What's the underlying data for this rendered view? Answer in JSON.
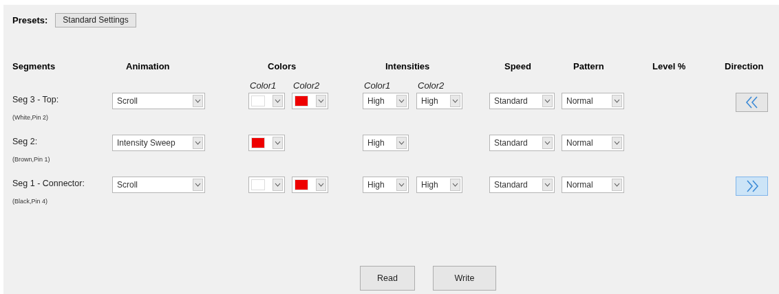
{
  "presets": {
    "label": "Presets:",
    "button": "Standard Settings"
  },
  "headers": [
    "Segments",
    "Animation",
    "Colors",
    "Intensities",
    "Speed",
    "Pattern",
    "Level %",
    "Direction"
  ],
  "subheaders": {
    "colors": [
      "Color1",
      "Color2"
    ],
    "intensities": [
      "Color1",
      "Color2"
    ]
  },
  "segments": [
    {
      "label": "Seg 3 - Top:",
      "wiring": "(White,Pin 2)",
      "animation": "Scroll",
      "colors": [
        {
          "color": "#ffffff"
        },
        {
          "color": "#ee0000"
        }
      ],
      "intensities": [
        "High",
        "High"
      ],
      "speed": "Standard",
      "pattern": "Normal",
      "direction": {
        "kind": "left",
        "pressed": false
      }
    },
    {
      "label": "Seg 2:",
      "wiring": "(Brown,Pin 1)",
      "animation": "Intensity Sweep",
      "colors": [
        {
          "color": "#ee0000"
        }
      ],
      "intensities": [
        "High"
      ],
      "speed": "Standard",
      "pattern": "Normal"
    },
    {
      "label": "Seg 1 - Connector:",
      "wiring": "(Black,Pin 4)",
      "animation": "Scroll",
      "colors": [
        {
          "color": "#ffffff"
        },
        {
          "color": "#ee0000"
        }
      ],
      "intensities": [
        "High",
        "High"
      ],
      "speed": "Standard",
      "pattern": "Normal",
      "direction": {
        "kind": "right",
        "pressed": true
      }
    }
  ],
  "buttons": [
    "Read",
    "Write"
  ]
}
